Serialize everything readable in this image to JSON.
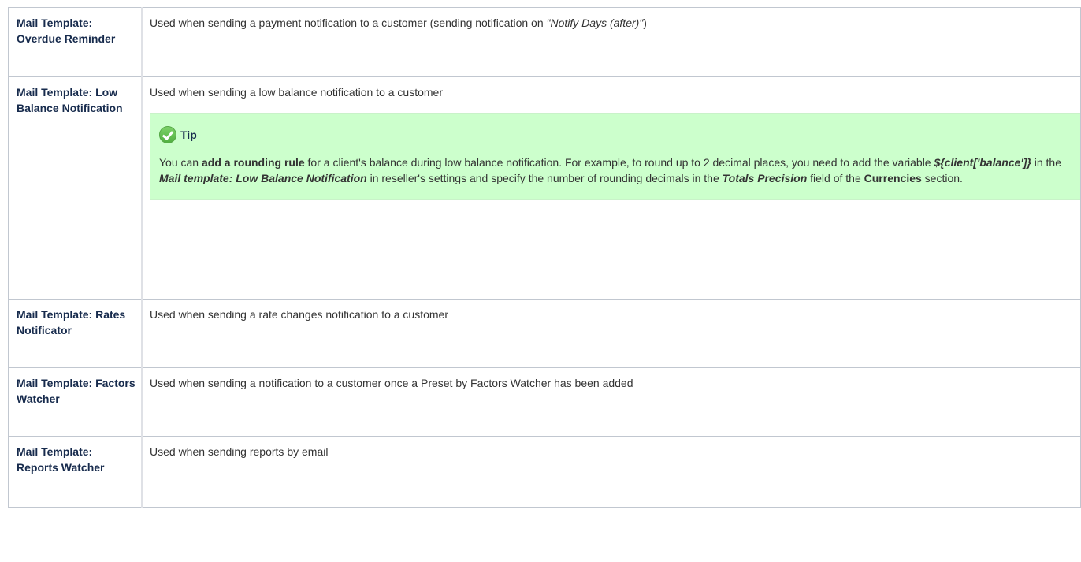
{
  "rows": [
    {
      "label": "Mail Template: Overdue Reminder",
      "desc_pre": "Used when sending a payment notification to a customer (sending notification on ",
      "desc_em": "\"Notify Days (after)\"",
      "desc_post": ")"
    },
    {
      "label": "Mail Template: Low Balance Notification",
      "desc": "Used when sending a low balance notification to a customer",
      "tip": {
        "title": "Tip",
        "icon": "check-circle-icon",
        "icon_color": "#5cbf4a",
        "background": "#ccffcc",
        "parts": [
          "You can ",
          "add a rounding rule",
          " for a client's balance during low balance notification.  For example, to round up to 2 decimal places, you need to add the variable ",
          "${client['balance']}",
          " in the ",
          "Mail template: Low Balance Notification",
          " in reseller's settings and specify the number of rounding decimals in the ",
          "Totals Precision",
          " field of the ",
          "Currencies",
          " section."
        ]
      }
    },
    {
      "label": "Mail Template: Rates Notificator",
      "desc": "Used when sending a rate changes notification to a customer"
    },
    {
      "label": "Mail Template: Factors Watcher",
      "desc": "Used when sending a notification to a customer once a Preset by Factors Watcher has been added"
    },
    {
      "label": "Mail Template: Reports Watcher",
      "desc": "Used when sending reports by email"
    }
  ]
}
